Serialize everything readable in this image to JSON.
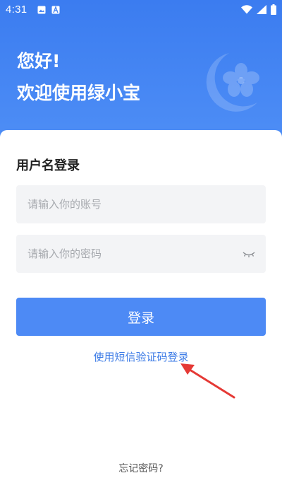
{
  "status_bar": {
    "time": "4:31",
    "icons": [
      "image-icon",
      "a-icon",
      "wifi-icon",
      "signal-icon",
      "battery-icon"
    ]
  },
  "header": {
    "greeting": "您好!",
    "welcome": "欢迎使用绿小宝",
    "logo": "moon-flower-logo"
  },
  "login_form": {
    "title": "用户名登录",
    "account_placeholder": "请输入你的账号",
    "password_placeholder": "请输入你的密码",
    "password_toggle_icon": "eye-closed-icon",
    "submit_label": "登录",
    "sms_login_label": "使用短信验证码登录",
    "forgot_password_label": "忘记密码?"
  },
  "annotation": {
    "arrow_color": "#e53935"
  },
  "colors": {
    "header_gradient_start": "#3b7cf0",
    "header_gradient_end": "#4f8ff6",
    "primary_button": "#4d8af5",
    "link": "#3c7be6",
    "input_background": "#f3f4f6"
  }
}
